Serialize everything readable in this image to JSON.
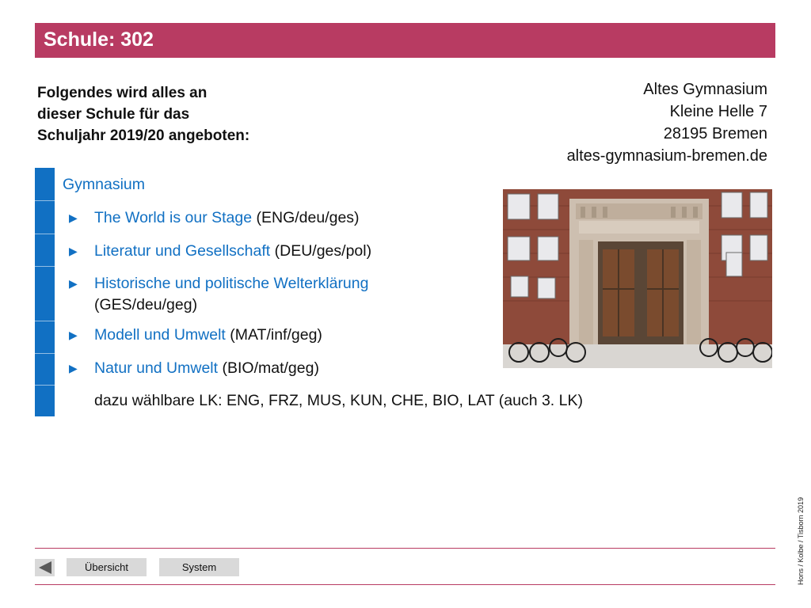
{
  "header": {
    "title": "Schule: 302",
    "accent_color": "#b83b62"
  },
  "intro": {
    "lines": [
      "Folgendes wird alles an",
      "dieser Schule für das",
      "Schuljahr 2019/20 angeboten:"
    ]
  },
  "address": {
    "name": "Altes Gymnasium",
    "street": "Kleine Helle 7",
    "city": "28195 Bremen",
    "website": "altes-gymnasium-bremen.de"
  },
  "offer": {
    "school_type": "Gymnasium",
    "profiles": [
      {
        "name": "The World is our Stage",
        "codes": "(ENG/deu/ges)"
      },
      {
        "name": "Literatur und Gesellschaft",
        "codes": "(DEU/ges/pol)"
      },
      {
        "name": "Historische und politische Welterklärung",
        "codes": "(GES/deu/geg)"
      },
      {
        "name": "Modell und Umwelt",
        "codes": "(MAT/inf/geg)"
      },
      {
        "name": "Natur und Umwelt",
        "codes": "(BIO/mat/geg)"
      }
    ],
    "elective_note": "dazu wählbare LK: ENG, FRZ, MUS, KUN, CHE, BIO, LAT (auch 3. LK)",
    "link_color": "#1170c3"
  },
  "footer": {
    "credit": "Hons / Kolbe / Tisborn 2019",
    "overview_label": "Übersicht",
    "system_label": "System",
    "back_icon": "triangle-left-icon"
  }
}
